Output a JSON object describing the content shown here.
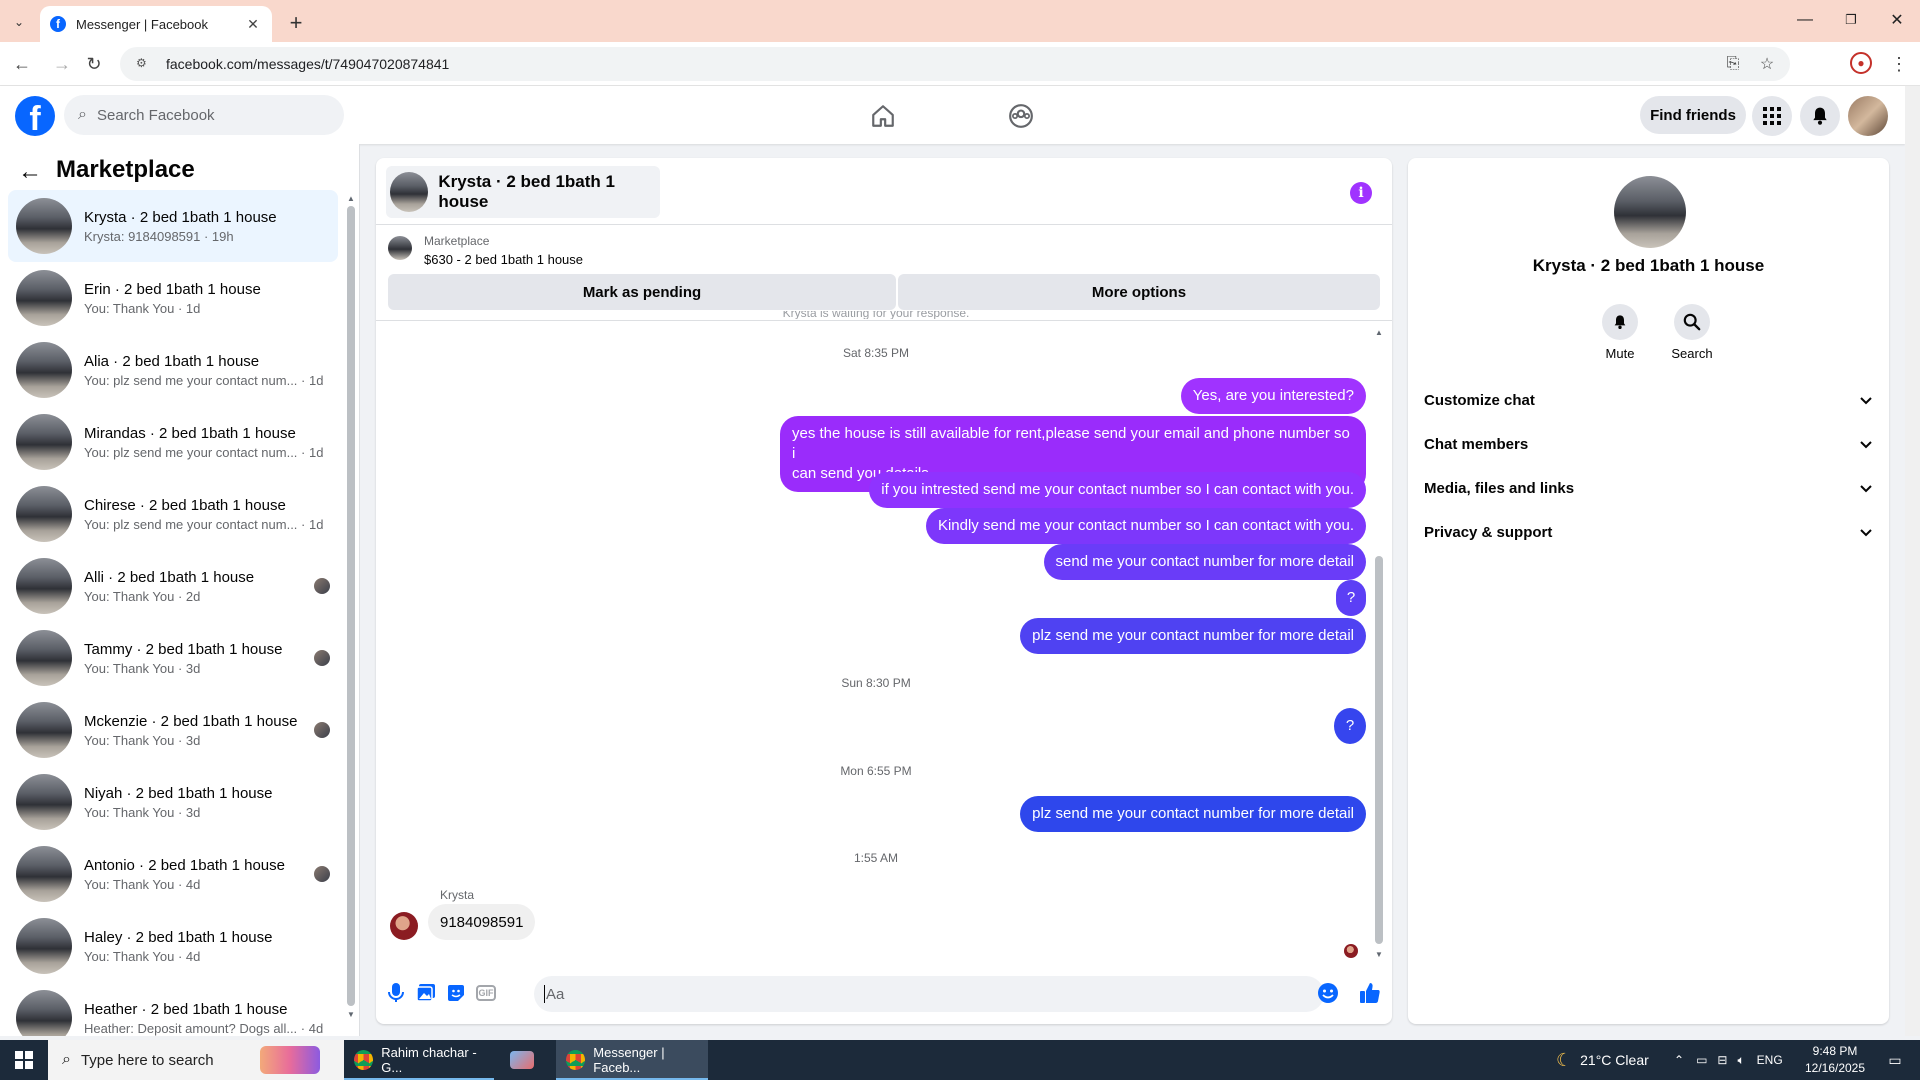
{
  "browser": {
    "tab_title": "Messenger | Facebook",
    "url": "facebook.com/messages/t/749047020874841"
  },
  "fb": {
    "search_placeholder": "Search Facebook",
    "find_friends": "Find friends"
  },
  "sidebar": {
    "title": "Marketplace",
    "conversations": [
      {
        "name": "Krysta · 2 bed 1bath 1 house",
        "snippet": "Krysta: 9184098591 · 19h",
        "active": true,
        "seen": false
      },
      {
        "name": "Erin · 2 bed 1bath 1 house",
        "snippet": "You: Thank You · 1d",
        "seen": false
      },
      {
        "name": "Alia · 2 bed 1bath 1 house",
        "snippet": "You: plz send me your contact num... · 1d",
        "seen": false
      },
      {
        "name": "Mirandas · 2 bed 1bath 1 house",
        "snippet": "You: plz send me your contact num... · 1d",
        "seen": false
      },
      {
        "name": "Chirese · 2 bed 1bath 1 house",
        "snippet": "You: plz send me your contact num... · 1d",
        "seen": false
      },
      {
        "name": "Alli · 2 bed 1bath 1 house",
        "snippet": "You: Thank You · 2d",
        "seen": true
      },
      {
        "name": "Tammy · 2 bed 1bath 1 house",
        "snippet": "You: Thank You · 3d",
        "seen": true
      },
      {
        "name": "Mckenzie · 2 bed 1bath 1 house",
        "snippet": "You: Thank You · 3d",
        "seen": true
      },
      {
        "name": "Niyah · 2 bed 1bath 1 house",
        "snippet": "You: Thank You · 3d",
        "seen": false
      },
      {
        "name": "Antonio · 2 bed 1bath 1 house",
        "snippet": "You: Thank You · 4d",
        "seen": true
      },
      {
        "name": "Haley · 2 bed 1bath 1 house",
        "snippet": "You: Thank You · 4d",
        "seen": false
      },
      {
        "name": "Heather · 2 bed 1bath 1 house",
        "snippet": "Heather: Deposit amount? Dogs all... · 4d",
        "seen": false
      }
    ]
  },
  "chat": {
    "title": "Krysta · 2 bed 1bath 1 house",
    "marketplace_label": "Marketplace",
    "marketplace_item": "$630 - 2 bed 1bath 1 house",
    "mark_pending": "Mark as pending",
    "more_options": "More options",
    "partial_notice": "Krysta is waiting for your response.",
    "timestamps": [
      "Sat 8:35 PM",
      "Sun 8:30 PM",
      "Mon 6:55 PM",
      "1:55 AM"
    ],
    "outgoing": [
      "Yes, are you interested?",
      "yes the house is still available for rent,please send your email and phone number so i",
      "can send you details",
      "if you intrested send me your contact number so I can contact with you.",
      "Kindly send me your contact number so I can contact with you.",
      "send me your contact number for more detail",
      "?",
      "plz send me your contact number for more detail",
      "?",
      "plz send me your contact number for more detail"
    ],
    "incoming_sender": "Krysta",
    "incoming_text": "9184098591",
    "input_placeholder": "Aa",
    "accent_purple": "#a033ff",
    "accent_blue": "#0866ff"
  },
  "info_panel": {
    "name": "Krysta · 2 bed 1bath 1 house",
    "mute": "Mute",
    "search": "Search",
    "sections": [
      "Customize chat",
      "Chat members",
      "Media, files and links",
      "Privacy & support"
    ]
  },
  "taskbar": {
    "search_placeholder": "Type here to search",
    "app1": "Rahim chachar - G...",
    "app2": "Messenger | Faceb...",
    "weather": "21°C  Clear",
    "lang": "ENG",
    "time": "9:48 PM",
    "date": "12/16/2025"
  }
}
